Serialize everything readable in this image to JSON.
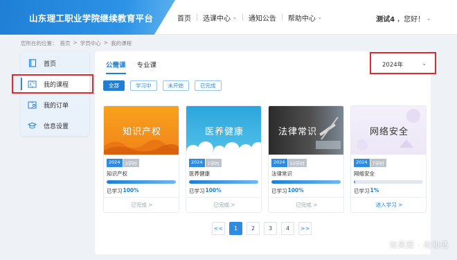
{
  "header": {
    "title": "山东理工职业学院继续教育平台",
    "nav": [
      {
        "label": "首页",
        "dropdown": false
      },
      {
        "label": "选课中心",
        "dropdown": true
      },
      {
        "label": "通知公告",
        "dropdown": false
      },
      {
        "label": "帮助中心",
        "dropdown": true
      }
    ],
    "user_name": "测试4",
    "greeting": "，您好！"
  },
  "breadcrumb": {
    "prefix": "您所在的位置：",
    "items": [
      "首页",
      "学员中心",
      "我的课程"
    ],
    "separator": ">"
  },
  "sidebar": {
    "items": [
      {
        "label": "首页",
        "icon": "home-icon",
        "active": false
      },
      {
        "label": "我的课程",
        "icon": "book-icon",
        "active": true
      },
      {
        "label": "我的订单",
        "icon": "order-icon",
        "active": false
      },
      {
        "label": "信息设置",
        "icon": "settings-icon",
        "active": false
      }
    ]
  },
  "main": {
    "tabs": [
      {
        "label": "公需课",
        "active": true
      },
      {
        "label": "专业课",
        "active": false
      }
    ],
    "filters": [
      {
        "label": "全部",
        "active": true
      },
      {
        "label": "学习中",
        "active": false
      },
      {
        "label": "未开始",
        "active": false
      },
      {
        "label": "已完成",
        "active": false
      }
    ],
    "year_select": {
      "value": "2024年"
    },
    "courses": [
      {
        "thumb_text": "知识产权",
        "year": "2024",
        "hours": "3学时",
        "name": "知识产权",
        "progress_prefix": "已学习",
        "progress": "100%",
        "progress_value": 1.0,
        "action": "已完成 >",
        "action_type": "done"
      },
      {
        "thumb_text": "医养健康",
        "year": "2024",
        "hours": "2学时",
        "name": "医养健康",
        "progress_prefix": "已学习",
        "progress": "100%",
        "progress_value": 1.0,
        "action": "已完成 >",
        "action_type": "done"
      },
      {
        "thumb_text": "法律常识",
        "year": "2024",
        "hours": "10学时",
        "name": "法律常识",
        "progress_prefix": "已学习",
        "progress": "100%",
        "progress_value": 1.0,
        "action": "已完成 >",
        "action_type": "done"
      },
      {
        "thumb_text": "网络安全",
        "year": "2024",
        "hours": "7学时",
        "name": "网络安全",
        "progress_prefix": "已学习",
        "progress": "1%",
        "progress_value": 0.01,
        "action": "进入学习 >",
        "action_type": "go"
      }
    ],
    "pagination": {
      "prev": "<<",
      "pages": [
        "1",
        "2",
        "3",
        "4"
      ],
      "current": "1",
      "next": ">>"
    }
  },
  "watermark": "效果图 · 政和通",
  "colors": {
    "accent": "#1f7fd6",
    "highlight_border": "#e0282e"
  }
}
